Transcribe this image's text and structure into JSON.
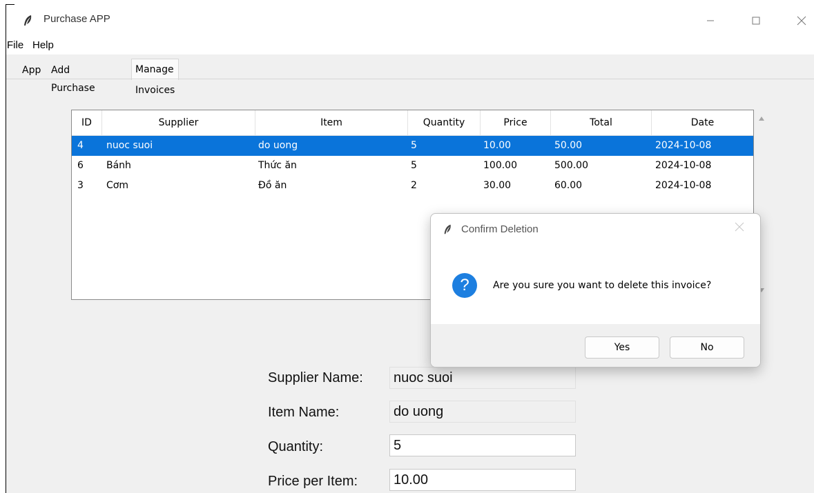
{
  "window": {
    "title": "Purchase APP"
  },
  "menu": {
    "items": [
      "File",
      "Help"
    ]
  },
  "tabs": [
    "App",
    "Add Purchase",
    "Manage Invoices"
  ],
  "table": {
    "columns": [
      "ID",
      "Supplier",
      "Item",
      "Quantity",
      "Price",
      "Total",
      "Date"
    ],
    "rows": [
      [
        "4",
        "nuoc suoi",
        "do uong",
        "5",
        "10.00",
        "50.00",
        "2024-10-08"
      ],
      [
        "6",
        "Bánh",
        "Thức ăn",
        "5",
        "100.00",
        "500.00",
        "2024-10-08"
      ],
      [
        "3",
        "Cơm",
        "Đồ ăn",
        "2",
        "30.00",
        "60.00",
        "2024-10-08"
      ]
    ]
  },
  "form": {
    "supplier_label": "Supplier Name:",
    "supplier_value": "nuoc suoi",
    "item_label": "Item Name:",
    "item_value": "do uong",
    "quantity_label": "Quantity:",
    "quantity_value": "5",
    "price_label": "Price per Item:",
    "price_value": "10.00"
  },
  "dialog": {
    "title": "Confirm Deletion",
    "message": "Are you sure you want to delete this invoice?",
    "question_glyph": "?",
    "yes_label": "Yes",
    "no_label": "No"
  },
  "colors": {
    "selection": "#0a74da",
    "dialog_icon": "#1d7fe0"
  }
}
